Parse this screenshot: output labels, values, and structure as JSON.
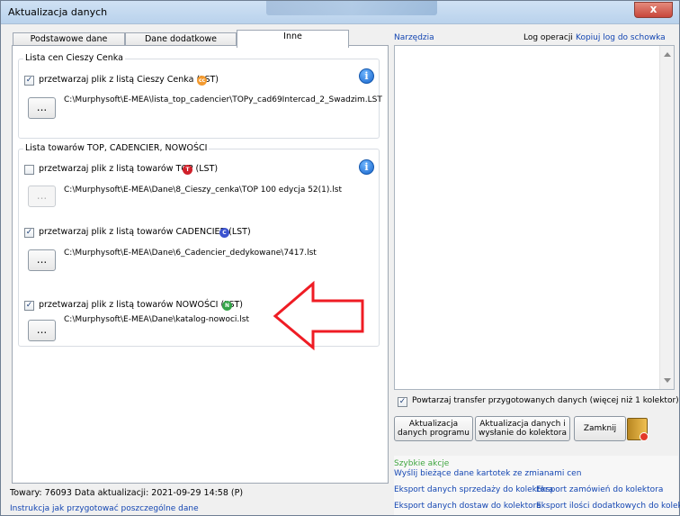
{
  "window": {
    "title": "Aktualizacja danych",
    "close_label": "x"
  },
  "tabs": [
    {
      "label": "Podstawowe dane"
    },
    {
      "label": "Dane dodatkowe"
    },
    {
      "label": "Inne"
    }
  ],
  "groups": {
    "price": {
      "title": "Lista cen Cieszy Cenka",
      "checkbox_label": "przetwarzaj plik z listą Cieszy Cenka (LST)",
      "checked": true,
      "path": "C:\\Murphysoft\\E-MEA\\lista_top_cadencier\\TOPy_cad69Intercad_2_Swadzim.LST",
      "button": "...",
      "badge": "cc",
      "badge_color": "#f39a2f"
    },
    "lists": {
      "title": "Lista towarów TOP, CADENCIER, NOWOŚCI",
      "items": [
        {
          "label": "przetwarzaj plik z listą towarów TOP (LST)",
          "checked": false,
          "path": "C:\\Murphysoft\\E-MEA\\Dane\\8_Cieszy_cenka\\TOP 100 edycja 52(1).lst",
          "button": "...",
          "badge": "T",
          "badge_color": "#d0202a"
        },
        {
          "label": "przetwarzaj plik z listą towarów CADENCIER (LST)",
          "checked": true,
          "path": "C:\\Murphysoft\\E-MEA\\Dane\\6_Cadencier_dedykowane\\7417.lst",
          "button": "...",
          "badge": "C",
          "badge_color": "#3b53cf"
        },
        {
          "label": "przetwarzaj plik z listą towarów NOWOŚCI (LST)",
          "checked": true,
          "path": "C:\\Murphysoft\\E-MEA\\Dane\\katalog-nowoci.lst",
          "button": "...",
          "badge": "N",
          "badge_color": "#35a449"
        }
      ]
    }
  },
  "status": {
    "text": "Towary: 76093  Data aktualizacji: 2021-09-29 14:58 (P)",
    "help_link": "Instrukcja jak przygotować poszczególne dane"
  },
  "right": {
    "tools_link": "Narzędzia",
    "log_label": "Log operacji",
    "copy_log_link": "Kopiuj log do schowka",
    "repeat_label": "Powtarzaj transfer przygotowanych danych (więcej niż 1 kolektor)",
    "repeat_checked": true,
    "buttons": {
      "update_program": "Aktualizacja danych programu",
      "update_send": "Aktualizacja danych  i wysłanie do kolektora",
      "close": "Zamknij"
    },
    "quick_actions": {
      "title": "Szybkie akcje",
      "links": [
        "Wyślij bieżące dane kartotek ze zmianami cen",
        "Eksport danych sprzedaży do kolektora",
        "Eksport zamówień do kolektora",
        "Eksport danych dostaw do kolektora",
        "Eksport ilości dodatkowych do kolektora"
      ]
    }
  },
  "colors": {
    "annotation_arrow": "#ef1c24",
    "link": "#1446b2",
    "info": "#1764cb"
  }
}
